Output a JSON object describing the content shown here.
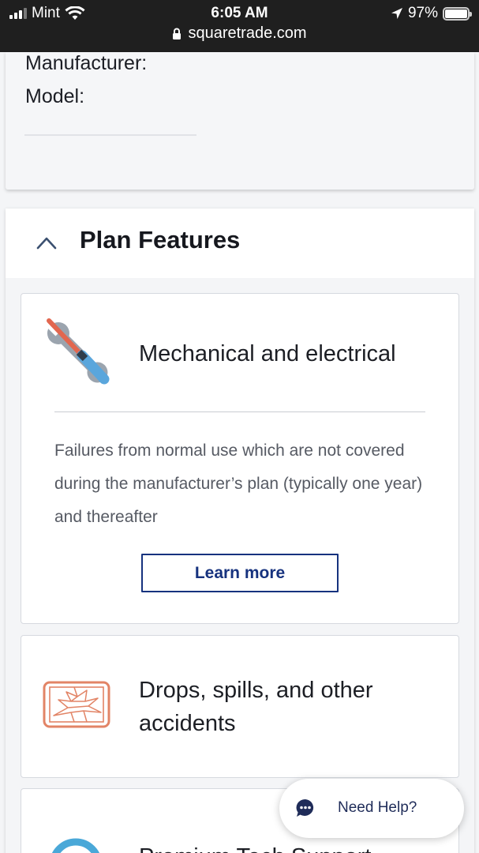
{
  "status_bar": {
    "carrier": "Mint",
    "time": "6:05 AM",
    "battery": "97%",
    "url": "squaretrade.com",
    "icons": [
      "signal-icon",
      "wifi-icon",
      "location-arrow-icon",
      "battery-icon",
      "lock-icon"
    ]
  },
  "device_info": {
    "manufacturer_label": "Manufacturer:",
    "model_label": "Model:"
  },
  "plan_features": {
    "title": "Plan Features",
    "chevron_icon": "chevron-up-icon",
    "features": [
      {
        "icon": "tools-icon",
        "title": "Mechanical and electrical",
        "description": "Failures from normal use which are not covered during the manufacturer’s plan (typically one year) and thereafter",
        "button_label": "Learn more"
      },
      {
        "icon": "cracked-screen-icon",
        "title": "Drops, spills, and other accidents"
      },
      {
        "icon": "headset-icon",
        "title": "Premium Tech Support"
      }
    ]
  },
  "help_widget": {
    "label": "Need Help?",
    "icon": "chat-icon"
  },
  "colors": {
    "brand_navy": "#16327e",
    "tool_red": "#e2674f",
    "tool_blue": "#5aa6dc",
    "crack_orange": "#e28466",
    "headset_blue": "#4aa8d8"
  }
}
